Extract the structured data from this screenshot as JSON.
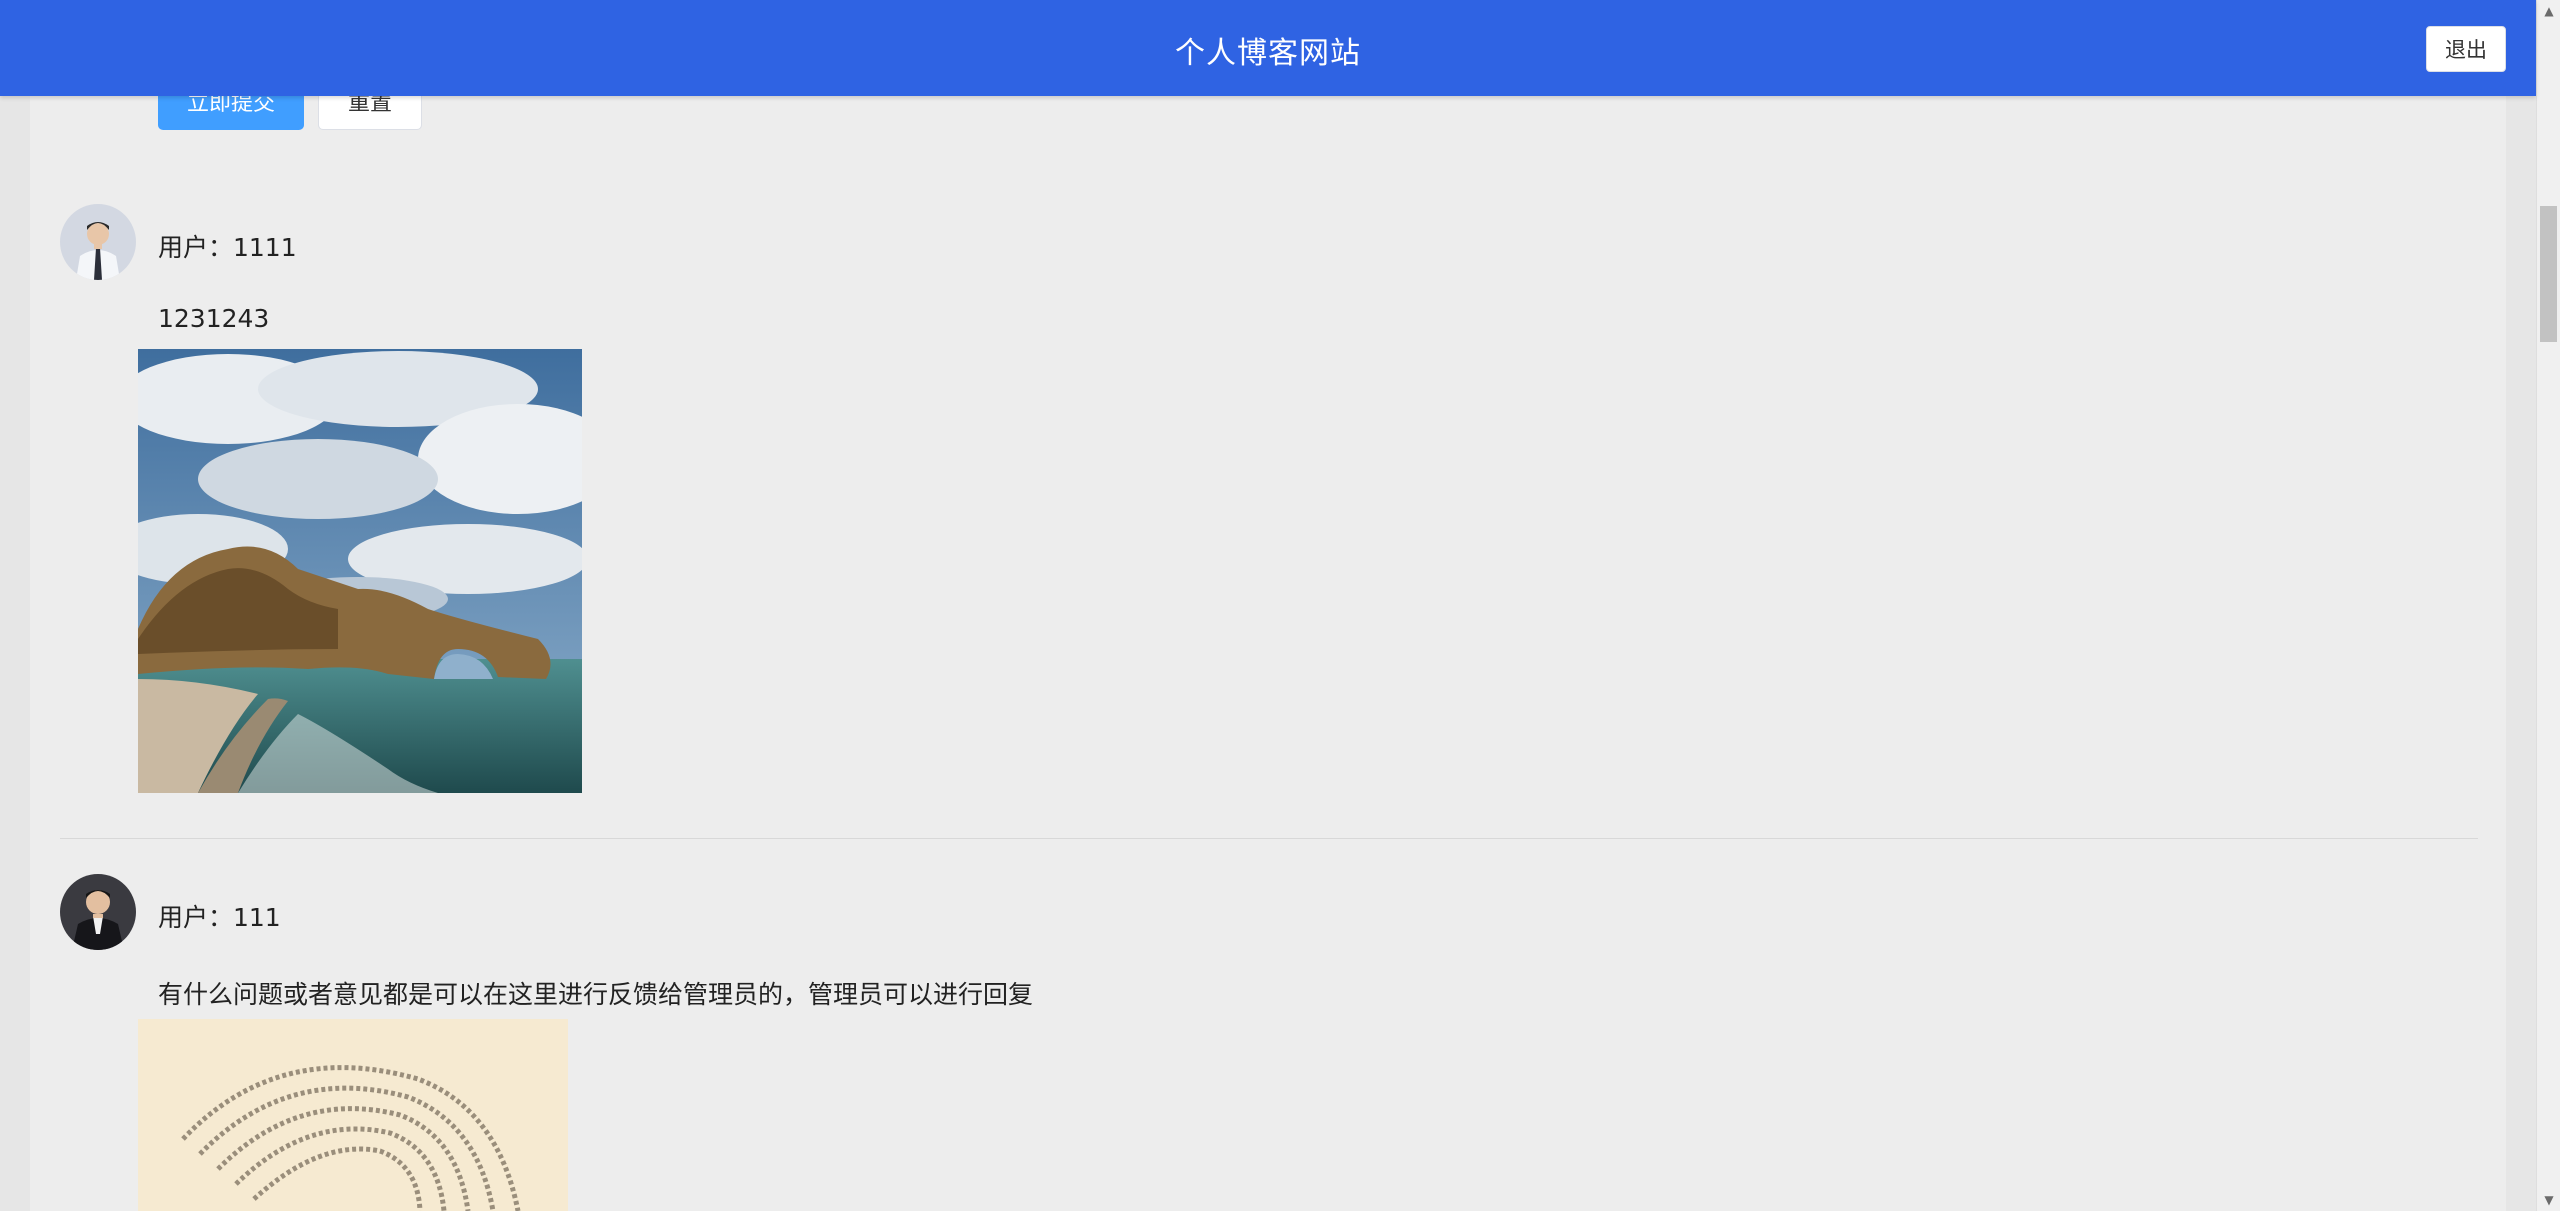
{
  "header": {
    "title": "个人博客网站",
    "logout_label": "退出",
    "background_color": "#2f63e3"
  },
  "form": {
    "submit_label": "立即提交",
    "reset_label": "重置",
    "submit_color": "#409eff"
  },
  "posts": [
    {
      "user_label": "用户：1111",
      "text": "1231243",
      "avatar_icon": "man-in-white-shirt-avatar",
      "image_icon": "sea-arch-coast-photo"
    },
    {
      "user_label": "用户：111",
      "text": "有什么问题或者意见都是可以在这里进行反馈给管理员的，管理员可以进行回复",
      "avatar_icon": "man-in-black-suit-avatar",
      "image_icon": "spiral-text-poster"
    }
  ],
  "scrollbar": {
    "up_icon": "scroll-up-arrow-icon",
    "down_icon": "scroll-down-arrow-icon"
  }
}
